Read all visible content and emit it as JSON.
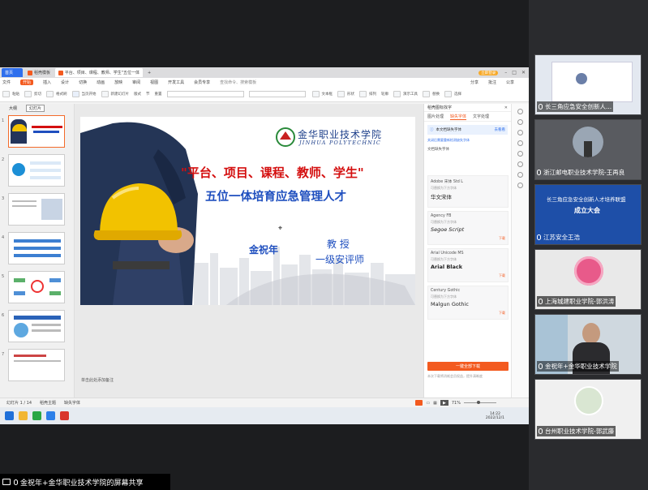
{
  "browser_tabs": [
    "首页",
    "稻壳模板",
    "平台、项目、课程、教师、学生\"五位一体..."
  ],
  "window_controls": {
    "user": "立即登录"
  },
  "menu": [
    "文件",
    "开始",
    "插入",
    "设计",
    "切换",
    "动画",
    "放映",
    "审阅",
    "视图",
    "开发工具",
    "会员专享",
    "查找命令、搜索模板"
  ],
  "menu_right": [
    "分享",
    "批注",
    "公享"
  ],
  "toolbar_labels": [
    "粘贴",
    "剪切",
    "格式刷",
    "当页开始",
    "新建幻灯片",
    "版式",
    "节",
    "重置",
    "文本框",
    "形状",
    "排列",
    "轮廓",
    "演示工具",
    "替换",
    "选择"
  ],
  "left_tabs": [
    "大纲",
    "幻灯片"
  ],
  "slide_numbers": [
    "1",
    "2",
    "3",
    "4",
    "5",
    "6",
    "7"
  ],
  "slide": {
    "school_cn": "金华职业技术学院",
    "school_en": "JINHUA POLYTECHNIC",
    "title_line1": "\"平台、项目、课程、教师、学生\"",
    "title_line2": "五位一体培育应急管理人才",
    "presenter": "金祝年",
    "title1": "教 授",
    "title2": "一级安评师"
  },
  "notes_placeholder": "单击此处添加备注",
  "right_panel": {
    "header": "稻壳图标找字",
    "tabs": [
      "图片处理",
      "缺失字体",
      "文字处理"
    ],
    "notice": "本文档缺失字体",
    "notice_action": "去看看",
    "sub": "关闭后需要重新检测缺失字体",
    "list_title": "文档缺失字体",
    "fonts": [
      {
        "missing": "Adobe 宋体 Std L",
        "replace_label": "可替换为下方字体",
        "replacement": "华文宋体",
        "action": ""
      },
      {
        "missing": "Agency FB",
        "replace_label": "可替换为下方字体",
        "replacement": "Segoe Script",
        "action": "下载"
      },
      {
        "missing": "Arial Unicode MS",
        "replace_label": "可替换为下方字体",
        "replacement": "Arial Black",
        "action": "下载"
      },
      {
        "missing": "Century Gothic",
        "replace_label": "可替换为下方字体",
        "replacement": "Malgun Gothic",
        "action": "下载"
      }
    ],
    "download_button": "一键全部下载",
    "footer_note": "本次下载将消耗会员权益，提升清晰度"
  },
  "perf": {
    "pct": "69",
    "up": "45.8",
    "down": "2.5"
  },
  "statusbar": {
    "slide_count": "幻灯片 1 / 14",
    "theme": "稻壳主题",
    "font_missing": "缺失字体",
    "zoom": "71%"
  },
  "taskbar": {
    "time": "14:22",
    "date": "2022/12/1"
  },
  "video_tiles": [
    {
      "name": "长三角应急安全创新人...",
      "color": "#e3e8f0"
    },
    {
      "name": "浙江邮电职业技术学院-王再良",
      "color": "#8a8d92"
    },
    {
      "name": "江苏安全王浩",
      "color": "#1e4fa8"
    },
    {
      "name": "上海城建职业学院-郭洪涛",
      "color": "#e9e9e9"
    },
    {
      "name": "金祝年+金华职业技术学院",
      "color": "#cfd8df"
    },
    {
      "name": "台州职业技术学院-郭武藤",
      "color": "#f0f0f0"
    }
  ],
  "video_slide_text": {
    "line1": "长三角应急安全创新人才培养联盟",
    "line2": "成立大会"
  },
  "bottom_bar": "金祝年+金华职业技术学院的屏幕共享",
  "colors": {
    "accent": "#f35a1f",
    "title_red": "#d40f0f",
    "title_blue": "#1f4fbf"
  }
}
